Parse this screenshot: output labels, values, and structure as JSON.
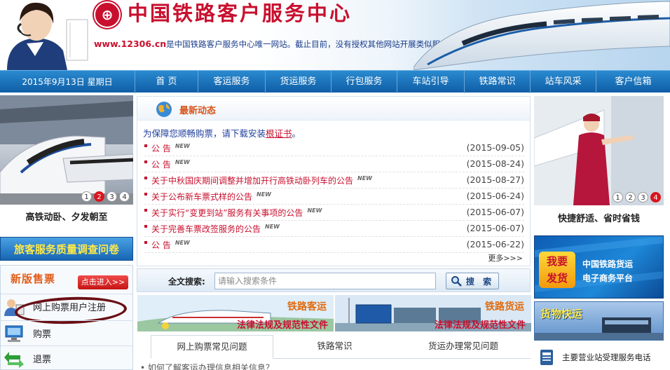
{
  "header": {
    "site_title": "中国铁路客户服务中心",
    "url": "www.12306.cn",
    "notice": "是中国铁路客户服务中心唯一网站。截止目前，没有授权其他网站开展类似服务内容，敬请广大用户注意"
  },
  "navbar": {
    "date": "2015年9月13日  星期日",
    "items": [
      "首  页",
      "客运服务",
      "货运服务",
      "行包服务",
      "车站引导",
      "铁路常识",
      "站车风采",
      "客户信箱"
    ]
  },
  "left": {
    "slide_pages": [
      "1",
      "2",
      "3",
      "4"
    ],
    "slide_active": 2,
    "slide_caption": "高铁动卧、夕发朝至",
    "survey_banner": "旅客服务质量调查问卷",
    "ticket_title": "新版售票",
    "enter_button": "点击进入>>",
    "links": [
      "网上购票用户注册",
      "购票",
      "退票"
    ]
  },
  "news": {
    "title": "最新动态",
    "intro": "为保障您顺畅购票，请下载安装",
    "intro_link": "根证书",
    "intro_end": "。",
    "new_tag": "NEW",
    "items": [
      {
        "text": "公 告",
        "date": "(2015-09-05)"
      },
      {
        "text": "公 告",
        "date": "(2015-08-24)"
      },
      {
        "text": "关于中秋国庆期间调整并增加开行高铁动卧列车的公告",
        "date": "(2015-08-27)"
      },
      {
        "text": "关于公布新车票式样的公告",
        "date": "(2015-06-24)"
      },
      {
        "text": "关于实行“变更到站”服务有关事项的公告",
        "date": "(2015-06-07)"
      },
      {
        "text": "关于完善车票改签服务的公告",
        "date": "(2015-06-07)"
      },
      {
        "text": "公 告",
        "date": "(2015-06-22)"
      }
    ],
    "more": "更多>>>"
  },
  "search": {
    "label": "全文搜索:",
    "placeholder": "请输入搜索条件",
    "button": "搜 索"
  },
  "promos": [
    {
      "category": "铁路客运",
      "subtitle": "法律法规及规范性文件"
    },
    {
      "category": "铁路货运",
      "subtitle": "法律法规及规范性文件"
    }
  ],
  "tabs": [
    "网上购票常见问题",
    "铁路常识",
    "货运办理常见问题"
  ],
  "tab_line": "• 如何了解客运办理信息相关信息？",
  "right": {
    "slide_pages": [
      "1",
      "2",
      "3",
      "4"
    ],
    "slide_active": 4,
    "slide_caption": "快捷舒适、省时省钱",
    "freight_badge": [
      "我要",
      "发货"
    ],
    "freight_text": [
      "中国铁路货运",
      "电子商务平台"
    ],
    "express_title": "货物快运",
    "hotline": "主要营业站受理服务电话"
  },
  "colors": {
    "brand_red": "#c8102e",
    "nav_blue": "#0f5ea6",
    "news_orange": "#d8541a"
  }
}
